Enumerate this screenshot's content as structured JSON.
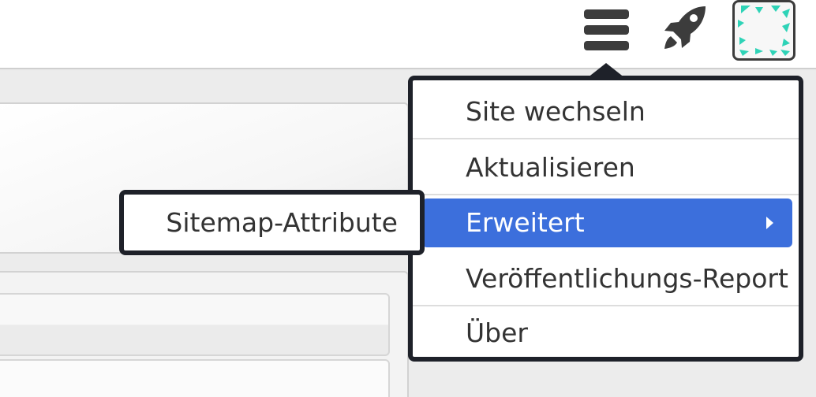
{
  "header": {
    "icons": {
      "menu": "hamburger-menu-icon",
      "rocket": "rocket-icon",
      "avatar": "avatar-pattern-icon"
    },
    "colors": {
      "icon_dark": "#3c3c3c",
      "avatar_accent": "#2ed3b7"
    }
  },
  "menu": {
    "items": [
      {
        "label": "Site wechseln"
      },
      {
        "label": "Aktualisieren"
      },
      {
        "label": "Erweitert",
        "active": true,
        "has_submenu": true
      },
      {
        "label": "Veröffentlichungs-Report"
      },
      {
        "label": "Über"
      }
    ],
    "colors": {
      "border": "#1e2129",
      "active_background": "#3c6fdc",
      "active_text": "#ffffff"
    }
  },
  "submenu": {
    "items": [
      {
        "label": "Sitemap-Attribute"
      }
    ]
  }
}
